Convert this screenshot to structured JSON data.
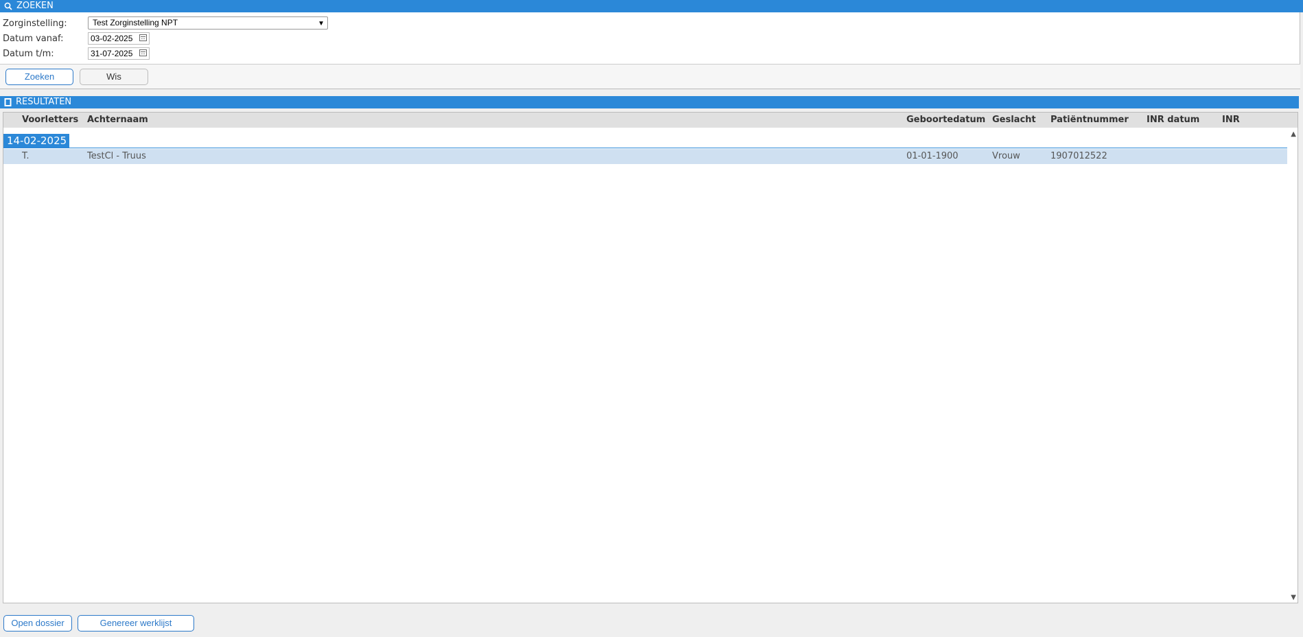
{
  "search": {
    "title": "ZOEKEN",
    "fields": [
      {
        "label": "Zorginstelling:",
        "value": "Test Zorginstelling NPT"
      },
      {
        "label": "Datum vanaf:",
        "value": "03-02-2025"
      },
      {
        "label": "Datum t/m:",
        "value": "31-07-2025"
      }
    ],
    "buttons": {
      "zoeken": "Zoeken",
      "wis": "Wis"
    }
  },
  "results": {
    "title": "RESULTATEN",
    "columns": [
      "Voorletters",
      "Achternaam",
      "Geboortedatum",
      "Geslacht",
      "Patiëntnummer",
      "INR datum",
      "INR"
    ],
    "groups": [
      {
        "date": "14-02-2025",
        "rows": [
          {
            "voorletters": "T.",
            "achternaam": "TestCl - Truus",
            "geboortedatum": "01-01-1900",
            "geslacht": "Vrouw",
            "patientnummer": "1907012522",
            "inr_datum": "",
            "inr": ""
          }
        ]
      }
    ]
  },
  "footer": {
    "open_dossier": "Open dossier",
    "genereer_werklijst": "Genereer werklijst"
  },
  "colors": {
    "accent": "#2b88d8",
    "row_selected": "#cfe0f1"
  }
}
